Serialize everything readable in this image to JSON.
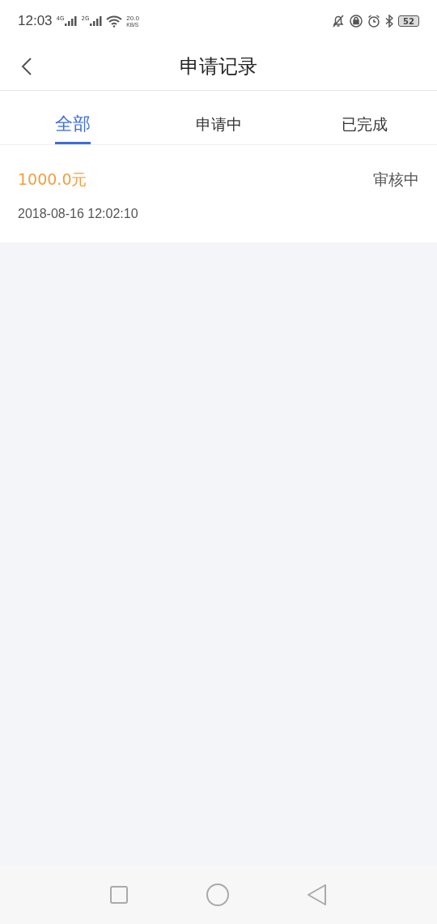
{
  "status_bar": {
    "time": "12:03",
    "network_1": "4G",
    "network_2": "2G",
    "speed_value": "20.0",
    "speed_unit": "KB/S",
    "battery": "52"
  },
  "header": {
    "title": "申请记录"
  },
  "tabs": [
    {
      "label": "全部",
      "selected": true
    },
    {
      "label": "申请中",
      "selected": false
    },
    {
      "label": "已完成",
      "selected": false
    }
  ],
  "records": [
    {
      "amount": "1000.0元",
      "status": "审核中",
      "time": "2018-08-16 12:02:10"
    }
  ]
}
